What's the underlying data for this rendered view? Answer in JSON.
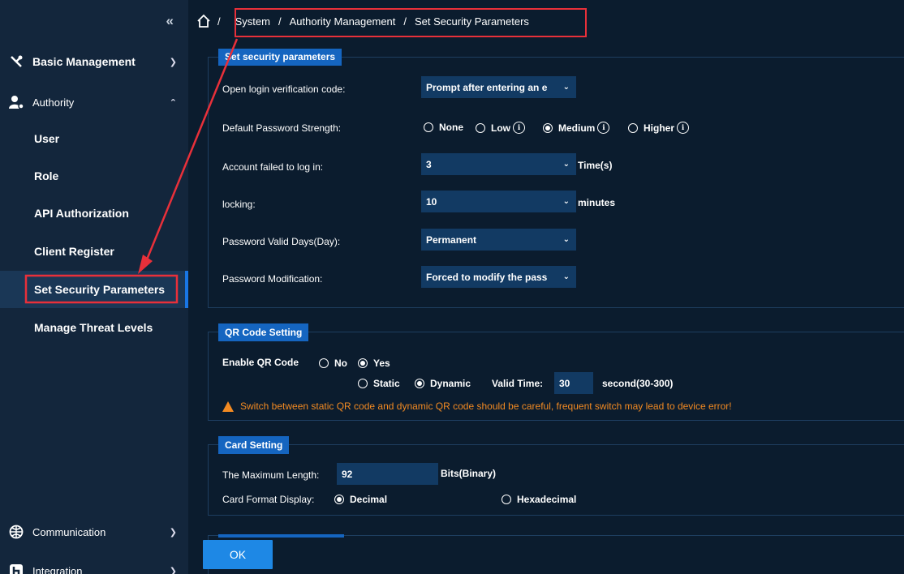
{
  "sidebar": {
    "collapse_icon": "double-chevron-left-icon",
    "basic_management": "Basic Management",
    "authority": "Authority",
    "items": [
      {
        "label": "User"
      },
      {
        "label": "Role"
      },
      {
        "label": "API Authorization"
      },
      {
        "label": "Client Register"
      },
      {
        "label": "Set Security Parameters",
        "active": true
      },
      {
        "label": "Manage Threat Levels"
      }
    ],
    "communication": "Communication",
    "integration": "Integration"
  },
  "breadcrumb": {
    "home_icon": "home-icon",
    "sep": "/",
    "items": [
      "System",
      "Authority Management",
      "Set Security Parameters"
    ]
  },
  "security": {
    "legend": "Set security parameters",
    "login_code_label": "Open login verification code:",
    "login_code_value": "Prompt after entering an e",
    "pwd_strength_label": "Default Password Strength:",
    "pwd_options": [
      "None",
      "Low",
      "Medium",
      "Higher"
    ],
    "pwd_selected": "Medium",
    "failed_label": "Account failed to log in:",
    "failed_value": "3",
    "failed_unit": "Time(s)",
    "locking_label": "locking:",
    "locking_value": "10",
    "locking_unit": "minutes",
    "valid_days_label": "Password Valid Days(Day):",
    "valid_days_value": "Permanent",
    "modification_label": "Password Modification:",
    "modification_value": "Forced to modify the pass"
  },
  "qr": {
    "legend": "QR Code Setting",
    "enable_label": "Enable QR Code",
    "no": "No",
    "yes": "Yes",
    "static": "Static",
    "dynamic": "Dynamic",
    "valid_time_label": "Valid Time:",
    "valid_time_value": "30",
    "valid_time_unit": "second(30-300)",
    "warning": "Switch between static QR code and dynamic QR code should be careful, frequent switch may lead to device error!"
  },
  "card": {
    "legend": "Card Setting",
    "max_length_label": "The Maximum Length:",
    "max_length_value": "92",
    "max_length_unit": "Bits(Binary)",
    "format_label": "Card Format Display:",
    "decimal": "Decimal",
    "hexadecimal": "Hexadecimal"
  },
  "ok_label": "OK",
  "colors": {
    "accent": "#1565c0",
    "highlight": "#e8303a",
    "warning": "#f28a22"
  }
}
